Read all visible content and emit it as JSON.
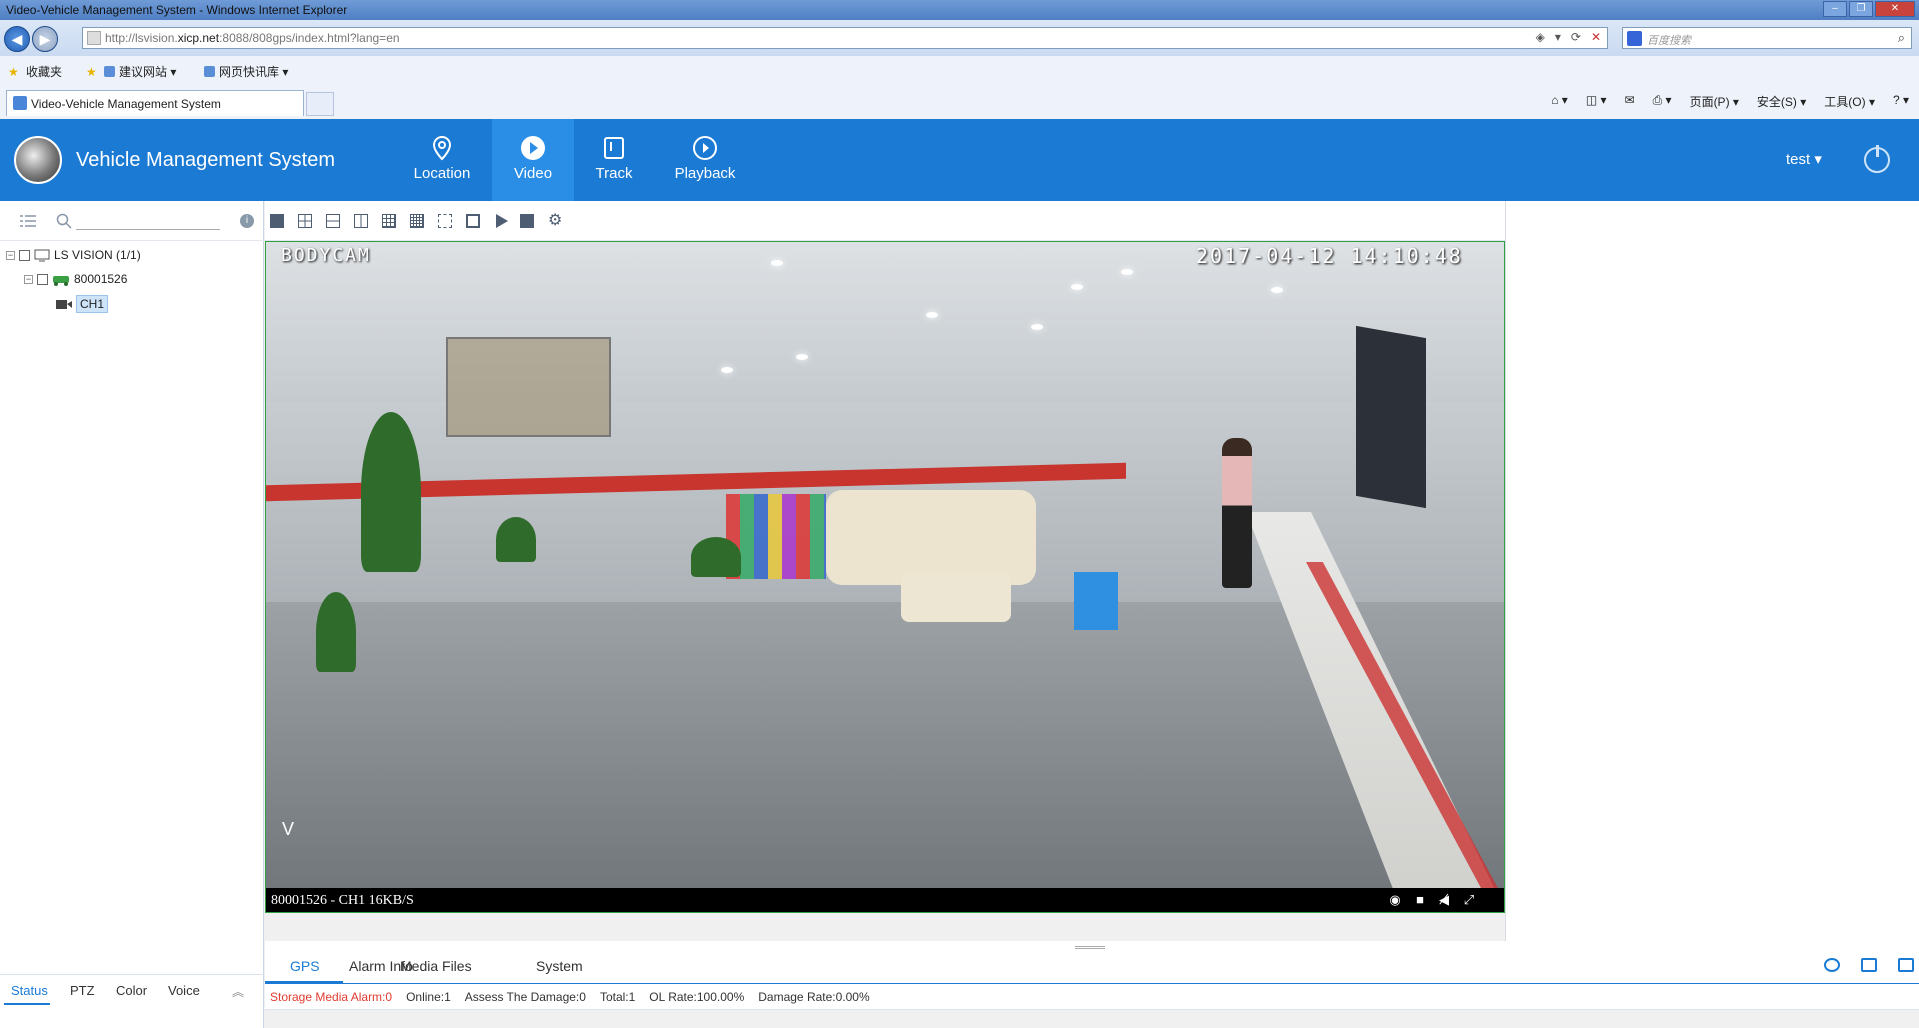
{
  "browser": {
    "window_title": "Video-Vehicle Management System - Windows Internet Explorer",
    "url_prefix": "http://lsvision.",
    "url_domain": "xicp.net",
    "url_suffix": ":8088/808gps/index.html?lang=en",
    "search_placeholder": "百度搜索",
    "favorites_label": "收藏夹",
    "fav_links": [
      "建议网站 ▾",
      "网页快讯库 ▾"
    ],
    "tab_title": "Video-Vehicle Management System",
    "commands": [
      "页面(P) ▾",
      "安全(S) ▾",
      "工具(O) ▾",
      "? ▾"
    ]
  },
  "app": {
    "title": "Vehicle Management System",
    "user": "test ▾",
    "nav": [
      {
        "label": "Location",
        "icon": "location-pin-icon",
        "active": false
      },
      {
        "label": "Video",
        "icon": "play-circle-icon",
        "active": true
      },
      {
        "label": "Track",
        "icon": "track-icon",
        "active": false
      },
      {
        "label": "Playback",
        "icon": "playback-icon",
        "active": false
      }
    ]
  },
  "tree": {
    "root": "LS VISION  (1/1)",
    "device": "80001526",
    "channel": "CH1"
  },
  "left_tabs": [
    "Status",
    "PTZ",
    "Color",
    "Voice"
  ],
  "video": {
    "osd_name": "BODYCAM",
    "osd_time": "2017-04-12 14:10:48",
    "osd_mark": "V",
    "info": "80001526 - CH1 16KB/S"
  },
  "bottom_tabs": [
    "GPS",
    "Alarm Info",
    "Media Files",
    "System"
  ],
  "status": {
    "alarm": "Storage Media Alarm:0",
    "online": "Online:1",
    "damage": "Assess The Damage:0",
    "total": "Total:1",
    "ol_rate": "OL Rate:100.00%",
    "damage_rate": "Damage Rate:0.00%"
  },
  "colors": {
    "header": "#1a7ad4",
    "active_nav": "#2a8ee6",
    "alarm": "#e23b2f",
    "video_border": "#2ea043"
  }
}
